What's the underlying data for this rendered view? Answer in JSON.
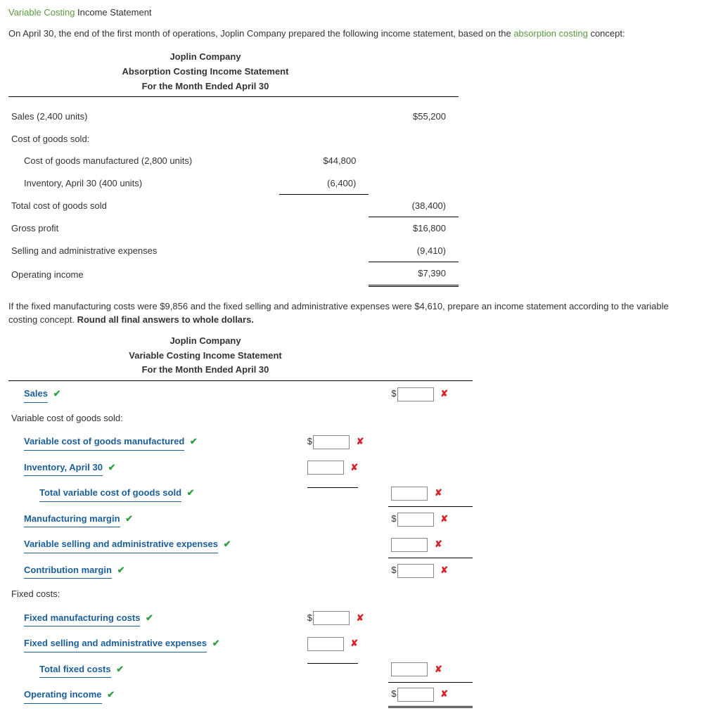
{
  "title_part1": "Variable Costing",
  "title_part2": " Income Statement",
  "intro_pre": "On April 30, the end of the first month of operations, Joplin Company prepared the following income statement, based on the ",
  "intro_link": "absorption costing",
  "intro_post": " concept:",
  "abs": {
    "h1": "Joplin Company",
    "h2": "Absorption Costing Income Statement",
    "h3": "For the Month Ended April 30",
    "r_sales_label": "Sales (2,400 units)",
    "r_sales_amt": "$55,200",
    "r_cogs_hdr": "Cost of goods sold:",
    "r_cogm_label": "Cost of goods manufactured (2,800 units)",
    "r_cogm_amt": "$44,800",
    "r_inv_label": "Inventory, April 30 (400 units)",
    "r_inv_amt": "(6,400)",
    "r_tcogs_label": "Total cost of goods sold",
    "r_tcogs_amt": "(38,400)",
    "r_gp_label": "Gross profit",
    "r_gp_amt": "$16,800",
    "r_sae_label": "Selling and administrative expenses",
    "r_sae_amt": "(9,410)",
    "r_oi_label": "Operating income",
    "r_oi_amt": "$7,390"
  },
  "instr_pre": "If the fixed manufacturing costs were $9,856 and the fixed selling and administrative expenses were $4,610, prepare an income statement according to the variable costing concept. ",
  "instr_bold": "Round all final answers to whole dollars.",
  "var": {
    "h1": "Joplin Company",
    "h2": "Variable Costing Income Statement",
    "h3": "For the Month Ended April 30",
    "sales": "Sales",
    "vcogs_hdr": "Variable cost of goods sold:",
    "vcogm": "Variable cost of goods manufactured",
    "inv": "Inventory, April 30",
    "tvcogs": "Total variable cost of goods sold",
    "mmargin": "Manufacturing margin",
    "vsae": "Variable selling and administrative expenses",
    "cmargin": "Contribution margin",
    "fixed_hdr": "Fixed costs:",
    "fmc": "Fixed manufacturing costs",
    "fsae": "Fixed selling and administrative expenses",
    "tfc": "Total fixed costs",
    "oi": "Operating income"
  },
  "marks": {
    "check": "✔",
    "cross": "✘",
    "dollar": "$"
  }
}
